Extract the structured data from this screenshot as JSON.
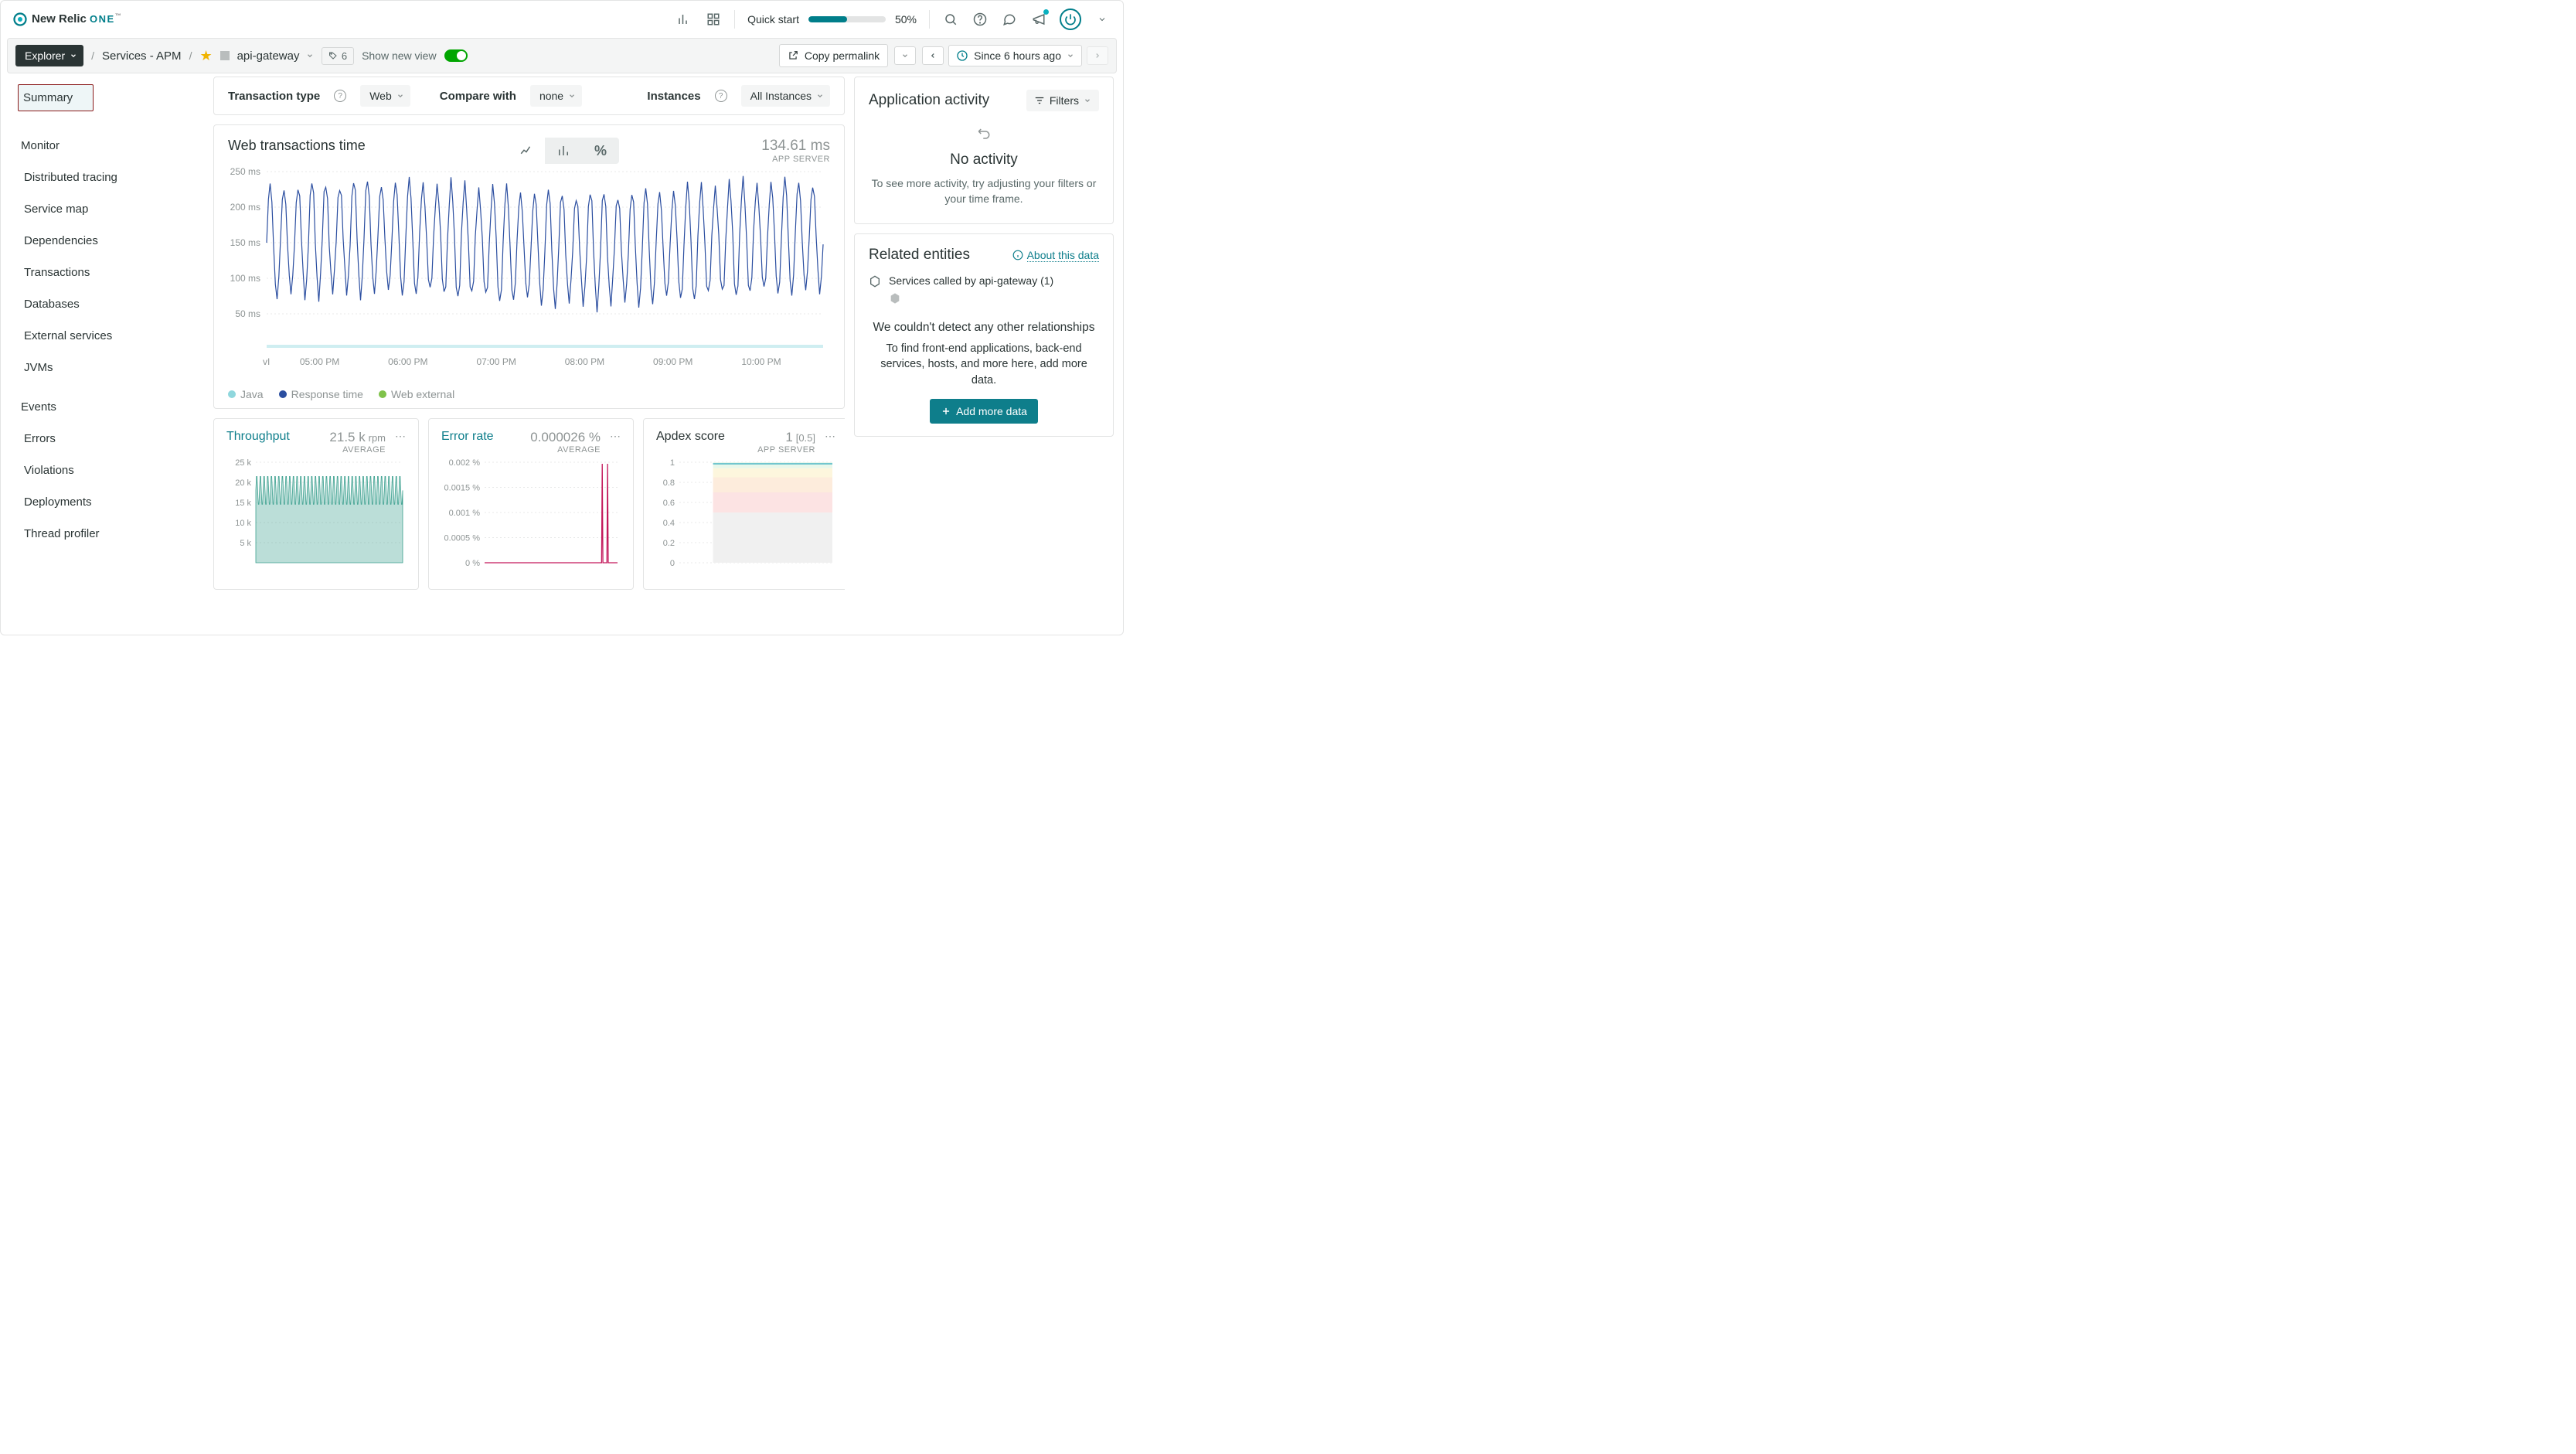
{
  "brand": {
    "name": "New Relic",
    "suffix": "ONE",
    "tm": "™"
  },
  "topbar": {
    "quick_start_label": "Quick start",
    "quick_start_percent": "50%"
  },
  "subbar": {
    "explorer_label": "Explorer",
    "crumb_services": "Services - APM",
    "entity_name": "api-gateway",
    "tag_count": "6",
    "show_new_view": "Show new view",
    "copy_permalink": "Copy permalink",
    "time_range": "Since 6 hours ago"
  },
  "sidebar": {
    "active": "Summary",
    "group_monitor": "Monitor",
    "monitor_items": [
      "Distributed tracing",
      "Service map",
      "Dependencies",
      "Transactions",
      "Databases",
      "External services",
      "JVMs"
    ],
    "group_events": "Events",
    "events_items": [
      "Errors",
      "Violations",
      "Deployments",
      "Thread profiler"
    ]
  },
  "controls": {
    "txn_type_label": "Transaction type",
    "txn_type_value": "Web",
    "compare_label": "Compare with",
    "compare_value": "none",
    "instances_label": "Instances",
    "instances_value": "All Instances"
  },
  "main_chart": {
    "title": "Web transactions time",
    "value": "134.61 ms",
    "sub": "APP SERVER",
    "legend": [
      {
        "label": "Java",
        "color": "#8fd7dd"
      },
      {
        "label": "Response time",
        "color": "#2b4ea0"
      },
      {
        "label": "Web external",
        "color": "#7fc24a"
      }
    ]
  },
  "mini": {
    "throughput": {
      "title": "Throughput",
      "value": "21.5 k",
      "unit": "rpm",
      "sub": "AVERAGE"
    },
    "error": {
      "title": "Error rate",
      "value": "0.000026 %",
      "unit": "",
      "sub": "AVERAGE"
    },
    "apdex": {
      "title": "Apdex score",
      "value": "1",
      "unit": "[0.5]",
      "sub": "APP SERVER"
    }
  },
  "activity_panel": {
    "title": "Application activity",
    "filters": "Filters",
    "no_activity_title": "No activity",
    "no_activity_body": "To see more activity, try adjusting your filters or your time frame."
  },
  "related_panel": {
    "title": "Related entities",
    "about": "About this data",
    "services_called": "Services called by api-gateway",
    "services_count": "(1)",
    "no_detect_title": "We couldn't detect any other relationships",
    "no_detect_body": "To find front-end applications, back-end services, hosts, and more here, add more data.",
    "add_more": "Add more data"
  },
  "chart_data": [
    {
      "type": "line",
      "title": "Web transactions time",
      "ylabel": "ms",
      "ylim": [
        0,
        250
      ],
      "yticks": [
        "50 ms",
        "100 ms",
        "150 ms",
        "200 ms",
        "250 ms"
      ],
      "xticks": [
        "05:00 PM",
        "06:00 PM",
        "07:00 PM",
        "08:00 PM",
        "09:00 PM",
        "10:00 PM"
      ],
      "series": [
        {
          "name": "Response time",
          "color": "#2b4ea0",
          "pattern": "oscillating 70-240 ms, ~40 cycles"
        },
        {
          "name": "Java",
          "color": "#8fd7dd",
          "pattern": "thin band near baseline ~4-8 ms"
        },
        {
          "name": "Web external",
          "color": "#7fc24a",
          "pattern": "not visible"
        }
      ]
    },
    {
      "type": "area",
      "title": "Throughput",
      "ylabel": "rpm",
      "ylim": [
        0,
        25000
      ],
      "yticks": [
        "5 k",
        "10 k",
        "15 k",
        "20 k",
        "25 k"
      ],
      "series": [
        {
          "name": "Throughput",
          "color": "#3ca08f",
          "pattern": "oscillating 14k-22k, ~40 cycles"
        }
      ]
    },
    {
      "type": "line",
      "title": "Error rate",
      "ylabel": "%",
      "ylim": [
        0,
        0.002
      ],
      "yticks": [
        "0 %",
        "0.0005 %",
        "0.001 %",
        "0.0015 %",
        "0.002 %"
      ],
      "series": [
        {
          "name": "Error rate",
          "color": "#c3185b",
          "pattern": "flat 0 with two spikes ~0.002 near end"
        }
      ]
    },
    {
      "type": "line",
      "title": "Apdex score",
      "ylabel": "",
      "ylim": [
        0,
        1
      ],
      "yticks": [
        "0",
        "0.2",
        "0.4",
        "0.6",
        "0.8",
        "1"
      ],
      "series": [
        {
          "name": "Apdex",
          "color": "#4ab5c4",
          "pattern": "flat ~0.98 with colored bands"
        }
      ]
    }
  ]
}
